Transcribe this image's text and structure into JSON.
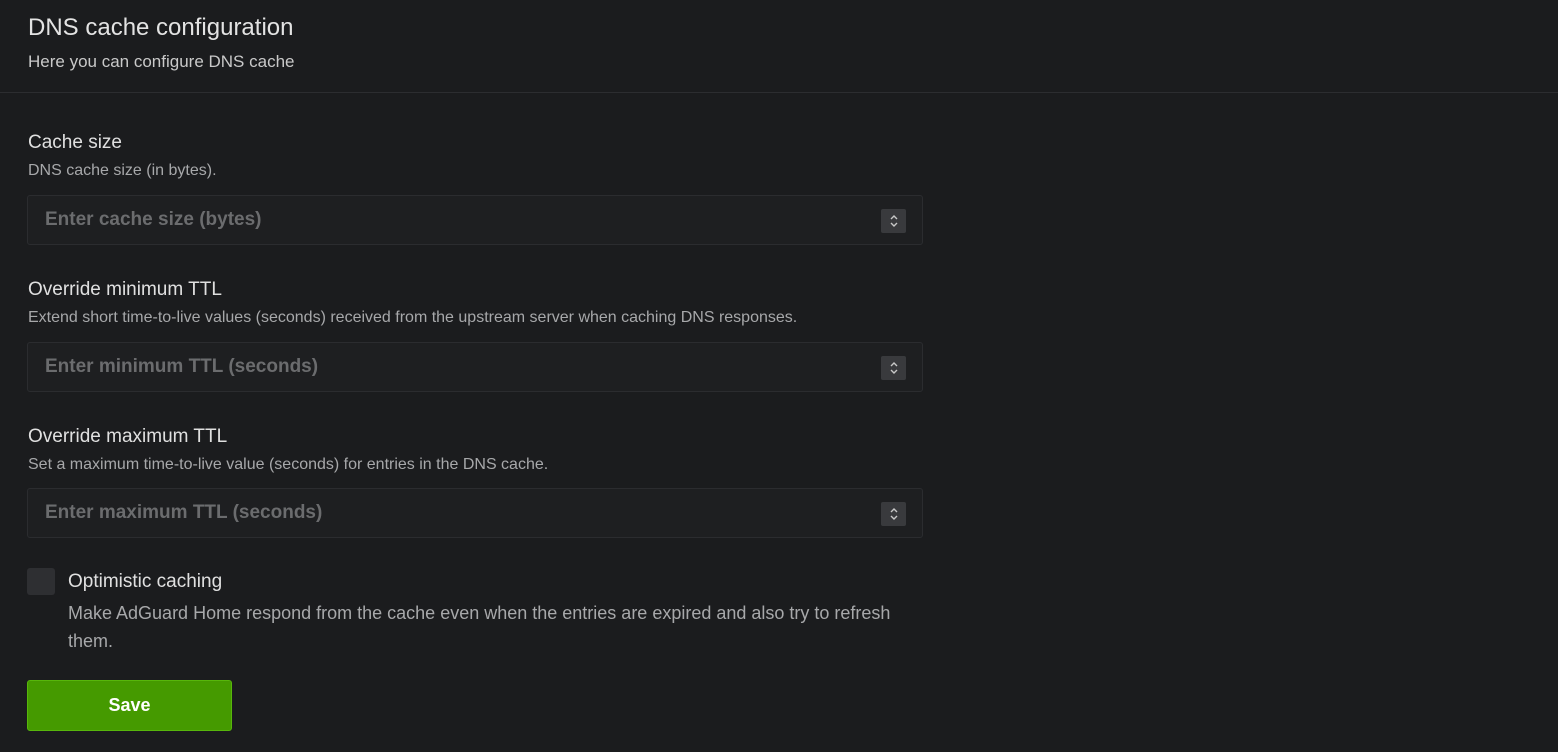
{
  "header": {
    "title": "DNS cache configuration",
    "subtitle": "Here you can configure DNS cache"
  },
  "fields": [
    {
      "label": "Cache size",
      "description": "DNS cache size (in bytes).",
      "placeholder": "Enter cache size (bytes)",
      "value": ""
    },
    {
      "label": "Override minimum TTL",
      "description": "Extend short time-to-live values (seconds) received from the upstream server when caching DNS responses.",
      "placeholder": "Enter minimum TTL (seconds)",
      "value": ""
    },
    {
      "label": "Override maximum TTL",
      "description": "Set a maximum time-to-live value (seconds) for entries in the DNS cache.",
      "placeholder": "Enter maximum TTL (seconds)",
      "value": ""
    }
  ],
  "optimistic_caching": {
    "label": "Optimistic caching",
    "description": "Make AdGuard Home respond from the cache even when the entries are expired and also try to refresh them.",
    "checked": false
  },
  "actions": {
    "save_label": "Save"
  },
  "icons": {
    "spinner": "chevron-up-down-icon"
  },
  "colors": {
    "background": "#1b1c1e",
    "save_button": "#459a00",
    "placeholder": "#6b6c6e"
  }
}
